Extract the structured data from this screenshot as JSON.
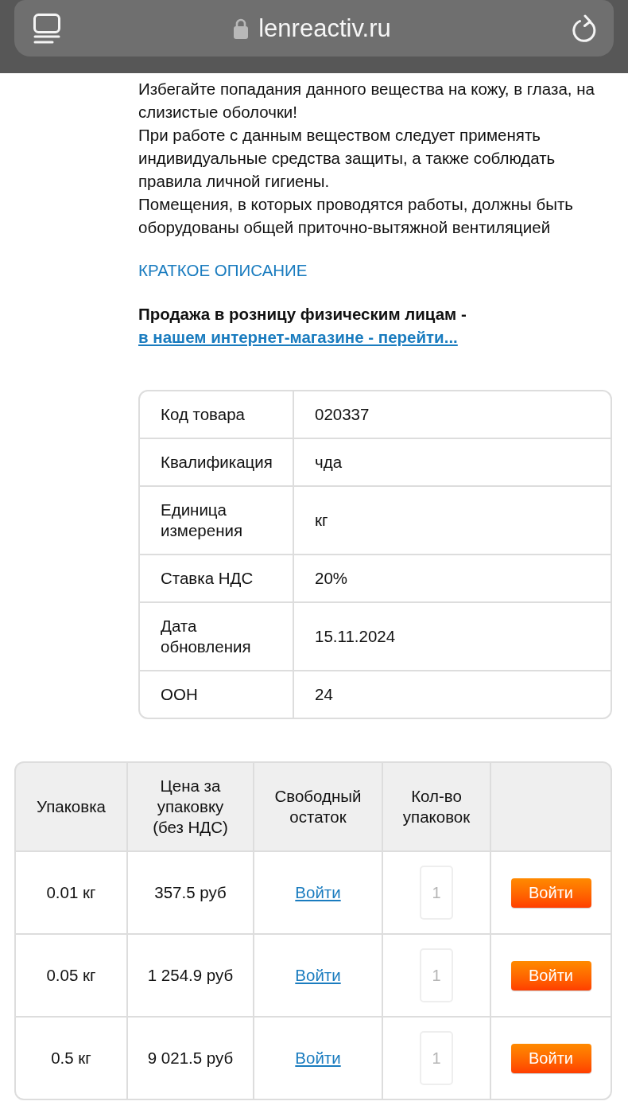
{
  "browser": {
    "url": "lenreactiv.ru"
  },
  "safety_text": [
    "Избегайте попадания данного вещества на кожу, в глаза, на слизистые оболочки!",
    "При работе с данным веществом следует применять индивидуальные средства защиты, а также соблюдать правила личной гигиены.",
    "Помещения, в которых проводятся работы, должны быть оборудованы общей приточно-вытяжной вентиляцией"
  ],
  "section_link": "КРАТКОЕ ОПИСАНИЕ",
  "retail_note": {
    "text": "Продажа в розницу физическим лицам -",
    "link": "в нашем интернет-магазине - перейти..."
  },
  "properties": [
    {
      "label": "Код товара",
      "value": "020337"
    },
    {
      "label": "Квалификация",
      "value": "чда"
    },
    {
      "label": "Единица измерения",
      "value": "кг"
    },
    {
      "label": "Ставка НДС",
      "value": "20%"
    },
    {
      "label": "Дата обновления",
      "value": "15.11.2024"
    },
    {
      "label": "ООН",
      "value": "24"
    }
  ],
  "packages": {
    "columns": [
      "Упаковка",
      "Цена за упаковку (без НДС)",
      "Свободный остаток",
      "Кол-во упаковок"
    ],
    "rows": [
      {
        "package": "0.01 кг",
        "price": "357.5 руб",
        "stock_link": "Войти",
        "quantity_placeholder": "1",
        "button": "Войти"
      },
      {
        "package": "0.05 кг",
        "price": "1 254.9 руб",
        "stock_link": "Войти",
        "quantity_placeholder": "1",
        "button": "Войти"
      },
      {
        "package": "0.5 кг",
        "price": "9 021.5 руб",
        "stock_link": "Войти",
        "quantity_placeholder": "1",
        "button": "Войти"
      }
    ]
  }
}
